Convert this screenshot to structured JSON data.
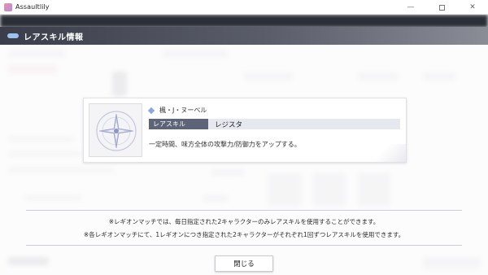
{
  "window": {
    "title": "Assaultlily",
    "minimize_glyph": "—",
    "close_glyph": "✕"
  },
  "dialog": {
    "title": "レアスキル情報",
    "character_name": "楓・J・ヌーベル",
    "skill_tag": "レアスキル",
    "skill_name": "レジスタ",
    "skill_description": "一定時間、味方全体の攻撃力/防御力をアップする。",
    "notice_lines": [
      "※レギオンマッチでは、毎日指定された2キャラクターのみレアスキルを使用することができます。",
      "※各レギオンマッチにて、1レギオンにつき指定された2キャラクターがそれぞれ1回ずつレアスキルを使用できます。"
    ],
    "close_label": "閉じる"
  },
  "colors": {
    "header_bg": "#3a3d4a",
    "skill_tag_bg": "#5e6478",
    "accent_diamond": "#8fa7e0"
  },
  "icons": {
    "app": "assaultlily-app-icon",
    "skill": "compass-star-skill-icon",
    "marker": "diamond-marker-icon"
  }
}
